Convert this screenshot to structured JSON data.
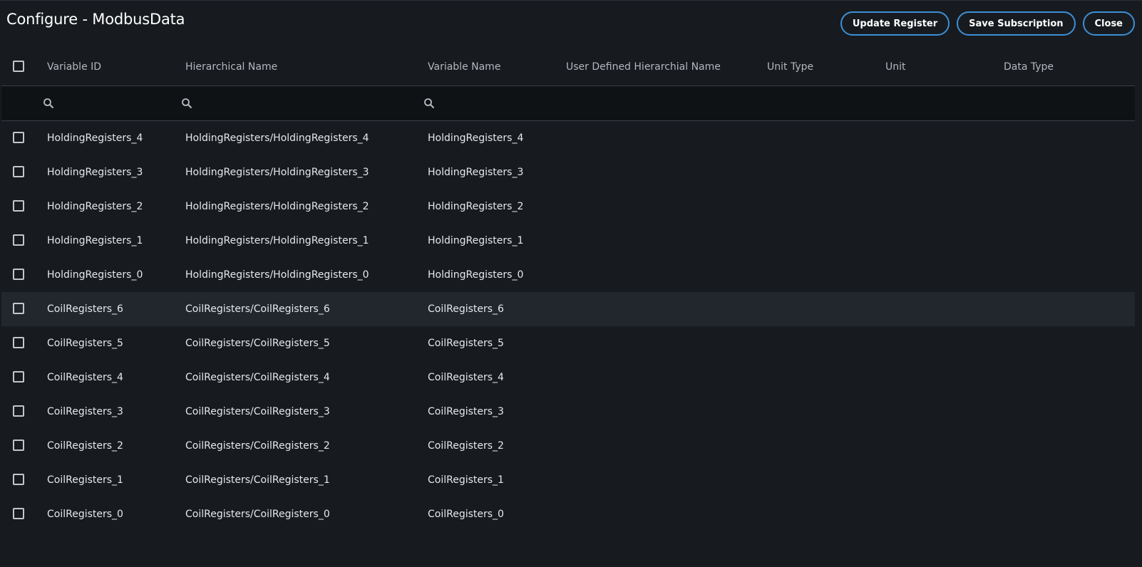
{
  "dialog": {
    "title": "Configure - ModbusData"
  },
  "buttons": {
    "update_register": "Update Register",
    "save_subscription": "Save Subscription",
    "close": "Close"
  },
  "table": {
    "columns": {
      "variable_id": "Variable ID",
      "hierarchical_name": "Hierarchical Name",
      "variable_name": "Variable Name",
      "user_defined_name": "User Defined Hierarchial Name",
      "unit_type": "Unit Type",
      "unit": "Unit",
      "data_type": "Data Type"
    },
    "rows": [
      {
        "id": "HoldingRegisters_4",
        "hierarchical": "HoldingRegisters/HoldingRegisters_4",
        "name": "HoldingRegisters_4"
      },
      {
        "id": "HoldingRegisters_3",
        "hierarchical": "HoldingRegisters/HoldingRegisters_3",
        "name": "HoldingRegisters_3"
      },
      {
        "id": "HoldingRegisters_2",
        "hierarchical": "HoldingRegisters/HoldingRegisters_2",
        "name": "HoldingRegisters_2"
      },
      {
        "id": "HoldingRegisters_1",
        "hierarchical": "HoldingRegisters/HoldingRegisters_1",
        "name": "HoldingRegisters_1"
      },
      {
        "id": "HoldingRegisters_0",
        "hierarchical": "HoldingRegisters/HoldingRegisters_0",
        "name": "HoldingRegisters_0"
      },
      {
        "id": "CoilRegisters_6",
        "hierarchical": "CoilRegisters/CoilRegisters_6",
        "name": "CoilRegisters_6"
      },
      {
        "id": "CoilRegisters_5",
        "hierarchical": "CoilRegisters/CoilRegisters_5",
        "name": "CoilRegisters_5"
      },
      {
        "id": "CoilRegisters_4",
        "hierarchical": "CoilRegisters/CoilRegisters_4",
        "name": "CoilRegisters_4"
      },
      {
        "id": "CoilRegisters_3",
        "hierarchical": "CoilRegisters/CoilRegisters_3",
        "name": "CoilRegisters_3"
      },
      {
        "id": "CoilRegisters_2",
        "hierarchical": "CoilRegisters/CoilRegisters_2",
        "name": "CoilRegisters_2"
      },
      {
        "id": "CoilRegisters_1",
        "hierarchical": "CoilRegisters/CoilRegisters_1",
        "name": "CoilRegisters_1"
      },
      {
        "id": "CoilRegisters_0",
        "hierarchical": "CoilRegisters/CoilRegisters_0",
        "name": "CoilRegisters_0"
      }
    ]
  },
  "colors": {
    "background": "#171b20",
    "accent": "#3d8fd6",
    "hover_row": "#22272d"
  },
  "icons": {
    "filter": "search-icon",
    "select": "checkbox-icon"
  }
}
